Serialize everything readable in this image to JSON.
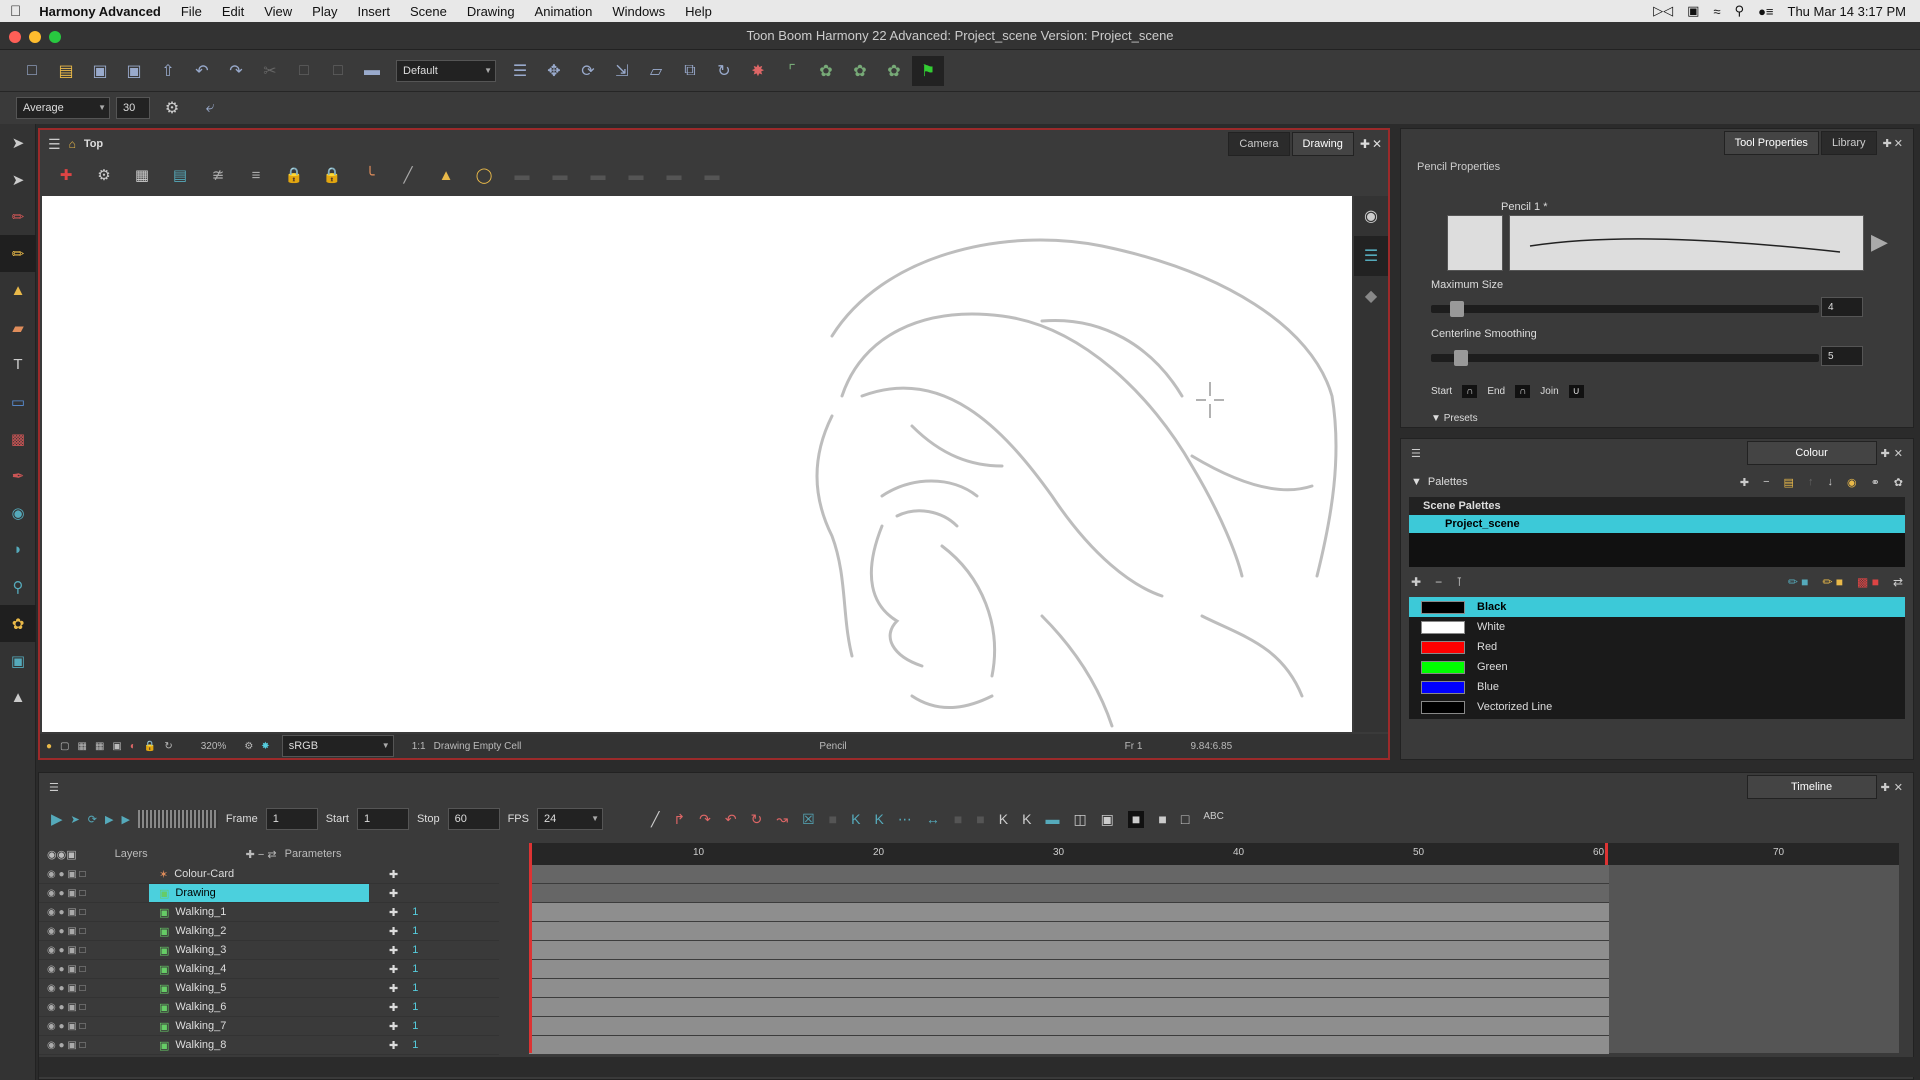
{
  "menubar": {
    "app": "Harmony Advanced",
    "items": [
      "File",
      "Edit",
      "View",
      "Play",
      "Insert",
      "Scene",
      "Drawing",
      "Animation",
      "Windows",
      "Help"
    ],
    "clock": "Thu Mar 14  3:17 PM"
  },
  "window": {
    "title": "Toon Boom Harmony 22 Advanced: Project_scene Version: Project_scene"
  },
  "toolbar": {
    "workspace": "Default",
    "smoothing_mode": "Average",
    "smoothing_value": "30"
  },
  "view": {
    "breadcrumb": "Top",
    "tabs": [
      {
        "label": "Camera"
      },
      {
        "label": "Drawing"
      }
    ],
    "status": {
      "zoom": "320%",
      "colorspace": "sRGB",
      "ratio": "1:1",
      "cell": "Drawing Empty Cell",
      "tool": "Pencil",
      "frame": "Fr 1",
      "coords": "9.84:6.85"
    }
  },
  "tool_properties": {
    "tabs": [
      {
        "label": "Tool Properties"
      },
      {
        "label": "Library"
      }
    ],
    "section": "Pencil Properties",
    "preset_name": "Pencil 1 *",
    "max_size_label": "Maximum Size",
    "max_size_value": "4",
    "max_size_level": 0.05,
    "smoothing_label": "Centerline Smoothing",
    "smoothing_value": "5",
    "smoothing_level": 0.06,
    "start_label": "Start",
    "end_label": "End",
    "join_label": "Join",
    "presets_label": "Presets"
  },
  "colour": {
    "title": "Colour",
    "palettes_label": "Palettes",
    "scene_palettes_label": "Scene Palettes",
    "palette_name": "Project_scene",
    "swatches": [
      {
        "name": "Black",
        "color": "#000000"
      },
      {
        "name": "White",
        "color": "#ffffff"
      },
      {
        "name": "Red",
        "color": "#ff0000"
      },
      {
        "name": "Green",
        "color": "#00ff00"
      },
      {
        "name": "Blue",
        "color": "#0000ff"
      },
      {
        "name": "Vectorized Line",
        "color": "#000000"
      }
    ]
  },
  "timeline": {
    "title": "Timeline",
    "frame_label": "Frame",
    "frame_value": "1",
    "start_label": "Start",
    "start_value": "1",
    "stop_label": "Stop",
    "stop_value": "60",
    "fps_label": "FPS",
    "fps_value": "24",
    "layers_label": "Layers",
    "parameters_label": "Parameters",
    "ruler": [
      "10",
      "20",
      "30",
      "40",
      "50",
      "60",
      "70"
    ],
    "layers": [
      {
        "name": "Colour-Card",
        "num": ""
      },
      {
        "name": "Drawing",
        "num": ""
      },
      {
        "name": "Walking_1",
        "num": "1"
      },
      {
        "name": "Walking_2",
        "num": "1"
      },
      {
        "name": "Walking_3",
        "num": "1"
      },
      {
        "name": "Walking_4",
        "num": "1"
      },
      {
        "name": "Walking_5",
        "num": "1"
      },
      {
        "name": "Walking_6",
        "num": "1"
      },
      {
        "name": "Walking_7",
        "num": "1"
      },
      {
        "name": "Walking_8",
        "num": "1"
      }
    ]
  }
}
